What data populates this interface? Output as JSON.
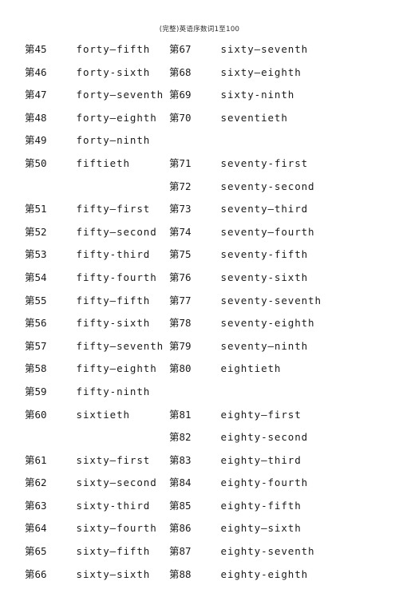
{
  "document": {
    "header": "(完整)英语序数词1至100",
    "ordinal_prefix": "第",
    "page_background": "#ffffff",
    "text_color": "#1a1a1a"
  },
  "columns": [
    {
      "name": "left-column",
      "entries": [
        {
          "prefix": "第",
          "number": "45",
          "word": "forty—fifth"
        },
        {
          "prefix": "第",
          "number": "46",
          "word": "forty-sixth"
        },
        {
          "prefix": "第",
          "number": "47",
          "word": "forty—seventh"
        },
        {
          "prefix": "第",
          "number": "48",
          "word": "forty—eighth"
        },
        {
          "prefix": "第",
          "number": "49",
          "word": "forty—ninth"
        },
        {
          "prefix": "第",
          "number": "50",
          "word": "fiftieth"
        },
        {
          "prefix": "",
          "number": "",
          "word": "",
          "blank": true
        },
        {
          "prefix": "第",
          "number": "51",
          "word": "fifty—first"
        },
        {
          "prefix": "第",
          "number": "52",
          "word": "fifty—second"
        },
        {
          "prefix": "第",
          "number": "53",
          "word": "fifty-third"
        },
        {
          "prefix": "第",
          "number": "54",
          "word": "fifty-fourth"
        },
        {
          "prefix": "第",
          "number": "55",
          "word": "fifty—fifth"
        },
        {
          "prefix": "第",
          "number": "56",
          "word": "fifty-sixth"
        },
        {
          "prefix": "第",
          "number": "57",
          "word": "fifty—seventh"
        },
        {
          "prefix": "第",
          "number": "58",
          "word": "fifty—eighth"
        },
        {
          "prefix": "第",
          "number": "59",
          "word": "fifty-ninth"
        },
        {
          "prefix": "第",
          "number": "60",
          "word": "sixtieth"
        },
        {
          "prefix": "",
          "number": "",
          "word": "",
          "blank": true
        },
        {
          "prefix": "第",
          "number": "61",
          "word": "sixty—first"
        },
        {
          "prefix": "第",
          "number": "62",
          "word": "sixty—second"
        },
        {
          "prefix": "第",
          "number": "63",
          "word": "sixty-third"
        },
        {
          "prefix": "第",
          "number": "64",
          "word": "sixty—fourth"
        },
        {
          "prefix": "第",
          "number": "65",
          "word": "sixty—fifth"
        },
        {
          "prefix": "第",
          "number": "66",
          "word": "sixty—sixth"
        }
      ]
    },
    {
      "name": "right-column",
      "entries": [
        {
          "prefix": "第",
          "number": "67",
          "word": "sixty—seventh"
        },
        {
          "prefix": "第",
          "number": "68",
          "word": "sixty—eighth"
        },
        {
          "prefix": "第",
          "number": "69",
          "word": "sixty-ninth"
        },
        {
          "prefix": "第",
          "number": "70",
          "word": "seventieth"
        },
        {
          "prefix": "",
          "number": "",
          "word": "",
          "blank": true
        },
        {
          "prefix": "第",
          "number": "71",
          "word": "seventy-first"
        },
        {
          "prefix": "第",
          "number": "72",
          "word": "seventy-second"
        },
        {
          "prefix": "第",
          "number": "73",
          "word": "seventy—third"
        },
        {
          "prefix": "第",
          "number": "74",
          "word": "seventy—fourth"
        },
        {
          "prefix": "第",
          "number": "75",
          "word": "seventy-fifth"
        },
        {
          "prefix": "第",
          "number": "76",
          "word": "seventy-sixth"
        },
        {
          "prefix": "第",
          "number": "77",
          "word": "seventy-seventh"
        },
        {
          "prefix": "第",
          "number": "78",
          "word": "seventy-eighth"
        },
        {
          "prefix": "第",
          "number": "79",
          "word": "seventy—ninth"
        },
        {
          "prefix": "第",
          "number": "80",
          "word": "eightieth"
        },
        {
          "prefix": "",
          "number": "",
          "word": "",
          "blank": true
        },
        {
          "prefix": "第",
          "number": "81",
          "word": "eighty—first"
        },
        {
          "prefix": "第",
          "number": "82",
          "word": "eighty-second"
        },
        {
          "prefix": "第",
          "number": "83",
          "word": "eighty—third"
        },
        {
          "prefix": "第",
          "number": "84",
          "word": "eighty-fourth"
        },
        {
          "prefix": "第",
          "number": "85",
          "word": "eighty-fifth"
        },
        {
          "prefix": "第",
          "number": "86",
          "word": "eighty—sixth"
        },
        {
          "prefix": "第",
          "number": "87",
          "word": "eighty-seventh"
        },
        {
          "prefix": "第",
          "number": "88",
          "word": "eighty-eighth"
        }
      ]
    }
  ]
}
